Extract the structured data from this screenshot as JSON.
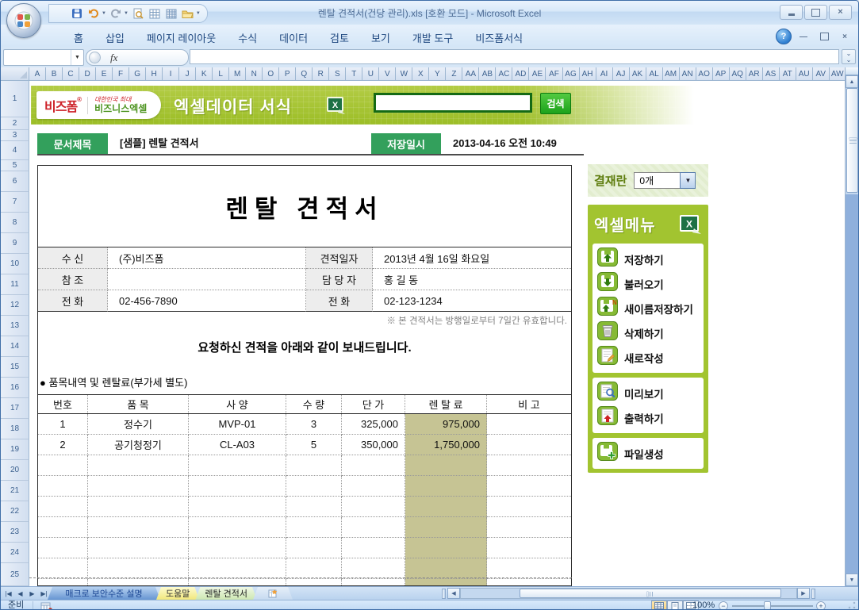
{
  "titlebar": {
    "title": "렌탈 견적서(건당 관리).xls  [호환 모드] - Microsoft Excel"
  },
  "ribbon": {
    "tabs": [
      "홈",
      "삽입",
      "페이지 레이아웃",
      "수식",
      "데이터",
      "검토",
      "보기",
      "개발 도구",
      "비즈폼서식"
    ]
  },
  "formula_bar": {
    "fx_label": "fx"
  },
  "grid": {
    "columns": [
      "A",
      "B",
      "C",
      "D",
      "E",
      "F",
      "G",
      "H",
      "I",
      "J",
      "K",
      "L",
      "M",
      "N",
      "O",
      "P",
      "Q",
      "R",
      "S",
      "T",
      "U",
      "V",
      "W",
      "X",
      "Y",
      "Z",
      "AA",
      "AB",
      "AC",
      "AD",
      "AE",
      "AF",
      "AG",
      "AH",
      "AI",
      "AJ",
      "AK",
      "AL",
      "AM",
      "AN",
      "AO",
      "AP",
      "AQ",
      "AR",
      "AS",
      "AT",
      "AU",
      "AV",
      "AW"
    ],
    "rows": [
      "1",
      "2",
      "3",
      "4",
      "5",
      "6",
      "7",
      "8",
      "9",
      "10",
      "11",
      "12",
      "13",
      "14",
      "15",
      "16",
      "17",
      "18",
      "19",
      "20",
      "21",
      "22",
      "23",
      "24",
      "25"
    ]
  },
  "banner": {
    "logo_text": "비즈폼",
    "logo_reg": "®",
    "tagline_top": "대한민국 최대",
    "tagline_bottom": "비즈니스엑셀",
    "title": "엑셀데이터 서식",
    "search_value": "",
    "search_button": "검색"
  },
  "doc_header": {
    "title_label": "문서제목",
    "title_value": "[샘플] 렌탈 견적서",
    "saved_label": "저장일시",
    "saved_value": "2013-04-16  오전 10:49"
  },
  "document": {
    "title": "렌탈 견적서",
    "info_rows": [
      {
        "label1": "수    신",
        "value1": "(주)비즈폼",
        "label2": "견적일자",
        "value2": "2013년 4월 16일 화요일"
      },
      {
        "label1": "참    조",
        "value1": "",
        "label2": "담 당 자",
        "value2": "홍 길 동"
      },
      {
        "label1": "전    화",
        "value1": "02-456-7890",
        "label2": "전    화",
        "value2": "02-123-1234"
      }
    ],
    "validity_note": "※ 본 견적서는 방행일로부터 7일간 유효합니다.",
    "message": "요청하신 견적을 아래와 같이 보내드립니다.",
    "items_caption": "● 품목내역 및 렌탈료(부가세 별도)",
    "items_headers": [
      "번호",
      "품  목",
      "사  양",
      "수  량",
      "단  가",
      "렌 탈 료",
      "비  고"
    ],
    "items_rows": [
      [
        "1",
        "정수기",
        "MVP-01",
        "3",
        "325,000",
        "975,000",
        ""
      ],
      [
        "2",
        "공기청정기",
        "CL-A03",
        "5",
        "350,000",
        "1,750,000",
        ""
      ]
    ],
    "empty_row_count": 7
  },
  "sidebar": {
    "approval_label": "결재란",
    "approval_value": "0개",
    "menu_title": "엑셀메뉴",
    "groups": [
      {
        "items": [
          {
            "icon": "save-icon",
            "label": "저장하기"
          },
          {
            "icon": "open-icon",
            "label": "불러오기"
          },
          {
            "icon": "save-as-icon",
            "label": "새이름저장하기"
          },
          {
            "icon": "delete-icon",
            "label": "삭제하기"
          },
          {
            "icon": "new-doc-icon",
            "label": "새로작성"
          }
        ]
      },
      {
        "items": [
          {
            "icon": "preview-icon",
            "label": "미리보기"
          },
          {
            "icon": "print-icon",
            "label": "출력하기"
          }
        ]
      },
      {
        "items": [
          {
            "icon": "file-create-icon",
            "label": "파일생성"
          }
        ]
      }
    ]
  },
  "sheet_tabs": {
    "tabs": [
      "매크로 보안수준 설명",
      "도움말",
      "렌탈 견적서"
    ]
  },
  "status": {
    "ready": "준비",
    "zoom": "100%"
  },
  "theme": {
    "banner_green": "#a5c62e",
    "badge_green": "#33a05c",
    "search_button_green": "#2db52d",
    "menu_green": "#a2c430",
    "rental_fee_khaki": "#c6c494"
  }
}
